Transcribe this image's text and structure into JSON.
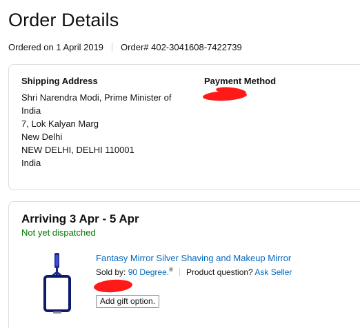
{
  "page": {
    "title": "Order Details",
    "ordered_on": "Ordered on 1 April 2019",
    "order_number": "Order# 402-3041608-7422739"
  },
  "address_box": {
    "shipping_label": "Shipping Address",
    "address_lines": [
      "Shri Narendra Modi, Prime Minister of",
      "India",
      "7, Lok Kalyan Marg",
      "New Delhi",
      "NEW DELHI, DELHI 110001",
      "India"
    ],
    "payment_label": "Payment Method",
    "redaction_color": "#ff1a1a"
  },
  "shipment": {
    "arriving": "Arriving 3 Apr - 5 Apr",
    "status": "Not yet dispatched",
    "status_color": "#007600",
    "product": {
      "title": "Fantasy Mirror Silver Shaving and Makeup Mirror",
      "sold_by_label": "Sold by:",
      "seller": "90 Degree.",
      "seller_mark": "®",
      "question_label": "Product question?",
      "ask_seller": "Ask Seller",
      "gift_button": "Add gift option.",
      "link_color": "#0066c0",
      "image_icon": "hanging-mirror-icon"
    }
  }
}
